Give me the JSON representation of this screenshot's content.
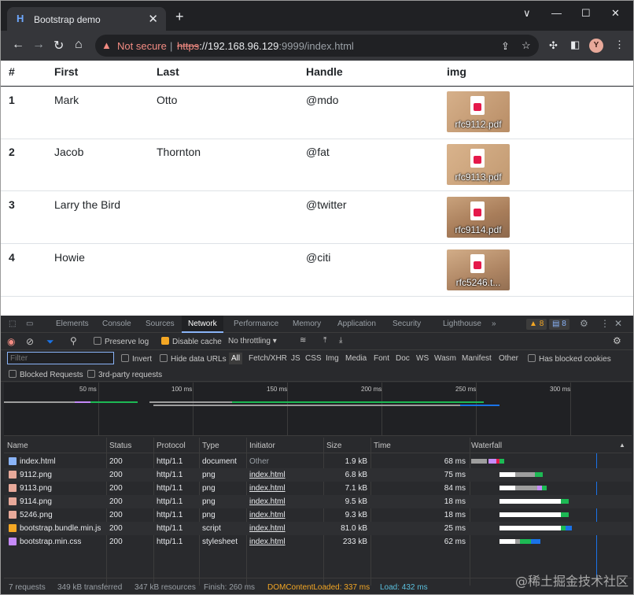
{
  "tab": {
    "title": "Bootstrap demo",
    "favicon": "H"
  },
  "window_controls": {
    "dropdown": "∨",
    "minimize": "—",
    "maximize": "☐",
    "close": "✕"
  },
  "address": {
    "not_secure": "Not secure",
    "separator": "|",
    "scheme": "https",
    "host": "://192.168.96.129",
    "rest": ":9999/index.html"
  },
  "profile": {
    "initial": "Y"
  },
  "table": {
    "headers": [
      "#",
      "First",
      "Last",
      "Handle",
      "img"
    ],
    "rows": [
      {
        "n": "1",
        "first": "Mark",
        "last": "Otto",
        "handle": "@mdo",
        "file": "rfc9112.pdf"
      },
      {
        "n": "2",
        "first": "Jacob",
        "last": "Thornton",
        "handle": "@fat",
        "file": "rfc9113.pdf"
      },
      {
        "n": "3",
        "first": "Larry the Bird",
        "last": "",
        "handle": "@twitter",
        "file": "rfc9114.pdf"
      },
      {
        "n": "4",
        "first": "Howie",
        "last": "",
        "handle": "@citi",
        "file": "rfc5246.t..."
      }
    ]
  },
  "devtools": {
    "tabs": [
      "Elements",
      "Console",
      "Sources",
      "Network",
      "Performance",
      "Memory",
      "Application",
      "Security",
      "Lighthouse"
    ],
    "active_tab": "Network",
    "more": "»",
    "warnings": "8",
    "messages": "8",
    "toolbar": {
      "preserve_log": "Preserve log",
      "disable_cache": "Disable cache",
      "throttling": "No throttling"
    },
    "filter": {
      "placeholder": "Filter",
      "invert": "Invert",
      "hide_data_urls": "Hide data URLs",
      "types": [
        "All",
        "Fetch/XHR",
        "JS",
        "CSS",
        "Img",
        "Media",
        "Font",
        "Doc",
        "WS",
        "Wasm",
        "Manifest",
        "Other"
      ],
      "has_blocked_cookies": "Has blocked cookies",
      "blocked_requests": "Blocked Requests",
      "third_party": "3rd-party requests"
    },
    "overview_ticks": [
      "50 ms",
      "100 ms",
      "150 ms",
      "200 ms",
      "250 ms",
      "300 ms"
    ],
    "columns": [
      "Name",
      "Status",
      "Protocol",
      "Type",
      "Initiator",
      "Size",
      "Time",
      "Waterfall"
    ],
    "requests": [
      {
        "name": "index.html",
        "status": "200",
        "protocol": "http/1.1",
        "type": "document",
        "initiator": "Other",
        "size": "1.9 kB",
        "time": "68 ms",
        "icon_color": "#8ab4f8"
      },
      {
        "name": "9112.png",
        "status": "200",
        "protocol": "http/1.1",
        "type": "png",
        "initiator": "index.html",
        "size": "6.8 kB",
        "time": "75 ms",
        "icon_color": "#e8a99a"
      },
      {
        "name": "9113.png",
        "status": "200",
        "protocol": "http/1.1",
        "type": "png",
        "initiator": "index.html",
        "size": "7.1 kB",
        "time": "84 ms",
        "icon_color": "#e8a99a"
      },
      {
        "name": "9114.png",
        "status": "200",
        "protocol": "http/1.1",
        "type": "png",
        "initiator": "index.html",
        "size": "9.5 kB",
        "time": "18 ms",
        "icon_color": "#e8a99a"
      },
      {
        "name": "5246.png",
        "status": "200",
        "protocol": "http/1.1",
        "type": "png",
        "initiator": "index.html",
        "size": "9.3 kB",
        "time": "18 ms",
        "icon_color": "#e8a99a"
      },
      {
        "name": "bootstrap.bundle.min.js",
        "status": "200",
        "protocol": "http/1.1",
        "type": "script",
        "initiator": "index.html",
        "size": "81.0 kB",
        "time": "25 ms",
        "icon_color": "#f4a724"
      },
      {
        "name": "bootstrap.min.css",
        "status": "200",
        "protocol": "http/1.1",
        "type": "stylesheet",
        "initiator": "index.html",
        "size": "233 kB",
        "time": "62 ms",
        "icon_color": "#c58af9"
      }
    ],
    "summary": {
      "requests": "7 requests",
      "transferred": "349 kB transferred",
      "resources": "347 kB resources",
      "finish": "Finish: 260 ms",
      "dcl": "DOMContentLoaded: 337 ms",
      "load": "Load: 432 ms"
    }
  },
  "watermark": "@稀土掘金技术社区",
  "colors": {
    "dcl": "#f4a724",
    "load": "#5bc0de",
    "wait": "#9e9e9e",
    "download": "#1a73e8",
    "ssl": "#c58af9",
    "content": "#1db954"
  }
}
